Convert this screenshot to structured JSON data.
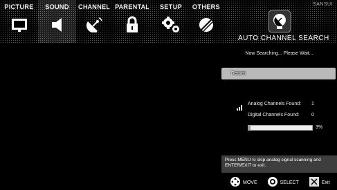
{
  "brand": "SANSUI",
  "tabs": [
    {
      "label": "PICTURE",
      "icon": "tv-icon",
      "active": false
    },
    {
      "label": "SOUND",
      "icon": "speaker-icon",
      "active": true
    },
    {
      "label": "CHANNEL",
      "icon": "satellite-dish-icon",
      "active": false
    },
    {
      "label": "PARENTAL",
      "icon": "padlock-icon",
      "active": false
    },
    {
      "label": "SETUP",
      "icon": "gears-icon",
      "active": false
    },
    {
      "label": "OTHERS",
      "icon": "others-icon",
      "active": false
    }
  ],
  "title": "AUTO CHANNEL SEARCH",
  "status": "Now Searching... Please Wait...",
  "return_label": "Return",
  "analog_label": "Analog Channels Found:",
  "analog_count": "1",
  "digital_label": "Digital Channels Found:",
  "digital_count": "0",
  "progress_value": 3,
  "progress_label": "3%",
  "help_text": "Press MENU to skip analog signal scanning and ENTER/EXIT to exit.",
  "footer": {
    "move": "MOVE",
    "select": "SELECT",
    "exit": "Exit"
  }
}
